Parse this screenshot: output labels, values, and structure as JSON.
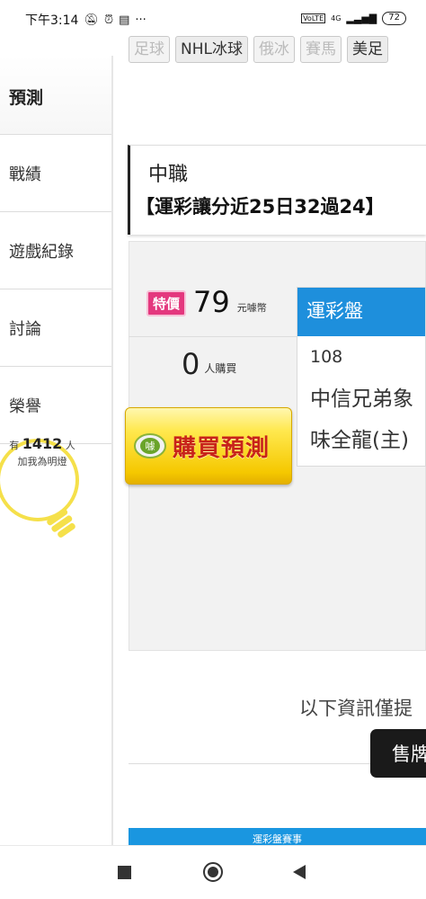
{
  "status_bar": {
    "time": "下午3:14",
    "network": "4G",
    "battery": "72"
  },
  "sport_tabs": [
    "足球",
    "NHL冰球",
    "俄冰",
    "賽馬",
    "美足"
  ],
  "sidebar": {
    "active_tab": "預測",
    "items": [
      "戰績",
      "遊戲紀錄",
      "討論",
      "榮譽"
    ],
    "lamp": {
      "prefix": "有",
      "count": "1412",
      "suffix": "人",
      "caption": "加我為明燈"
    }
  },
  "league_card": {
    "league": "中職",
    "record": "【運彩讓分近25日32過24】"
  },
  "offer": {
    "badge": "特價",
    "price": "79",
    "price_unit": "元噱幣",
    "buyers": "0",
    "buyers_unit": "人購買",
    "buy_icon_text": "噱",
    "buy_label": "購買預測"
  },
  "game_card": {
    "header": "運彩盤",
    "number": "108",
    "team1": "中信兄弟象",
    "team2": "味全龍(主)"
  },
  "info_text": "以下資訊僅提",
  "sell_button": "售牌",
  "blue_bar_text": "運彩盤賽事"
}
